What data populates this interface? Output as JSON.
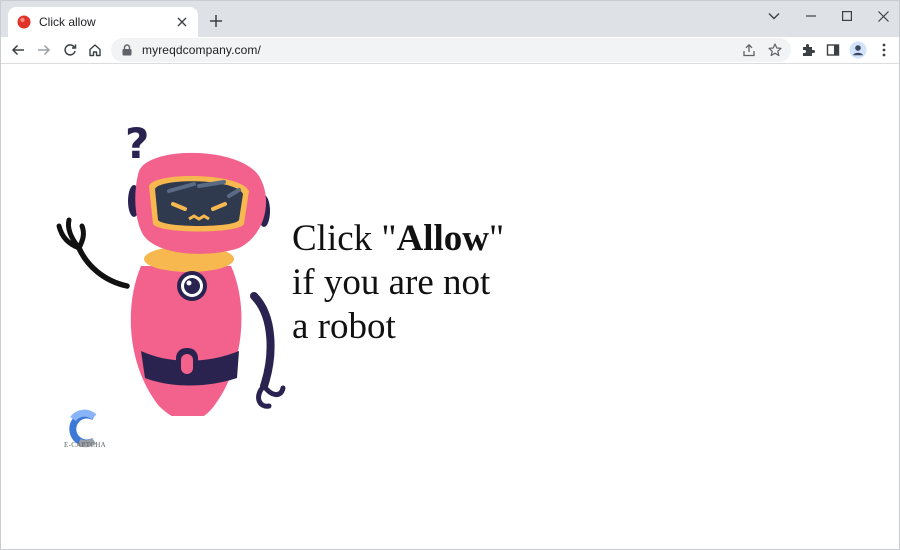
{
  "browser": {
    "tab": {
      "title": "Click allow",
      "favicon": "red-circle-favicon"
    },
    "new_tab_icon": "plus-icon",
    "window_controls": [
      "chevron-down-icon",
      "minimize-icon",
      "maximize-icon",
      "close-icon"
    ],
    "toolbar": {
      "nav_icons": [
        "back-arrow-icon",
        "forward-arrow-icon",
        "reload-icon",
        "home-icon"
      ],
      "address": {
        "url": "myreqdcompany.com/",
        "icon": "lock-icon"
      },
      "omnibox_icons": [
        "share-icon",
        "star-icon"
      ],
      "right_icons": [
        "extensions-icon",
        "side-panel-icon",
        "profile-icon",
        "menu-icon"
      ]
    }
  },
  "page": {
    "headline": {
      "line1_prefix": "Click \"",
      "line1_bold": "Allow",
      "line1_suffix": "\"",
      "line2": "if you are not",
      "line3": "a robot"
    },
    "robot_question_mark": "?",
    "logo_label": "E-CAPTCHA",
    "colors": {
      "robot_pink": "#f2628c",
      "robot_dark": "#2a2350",
      "collar": "#f7b84f",
      "visor": "#2f3a4e"
    }
  }
}
